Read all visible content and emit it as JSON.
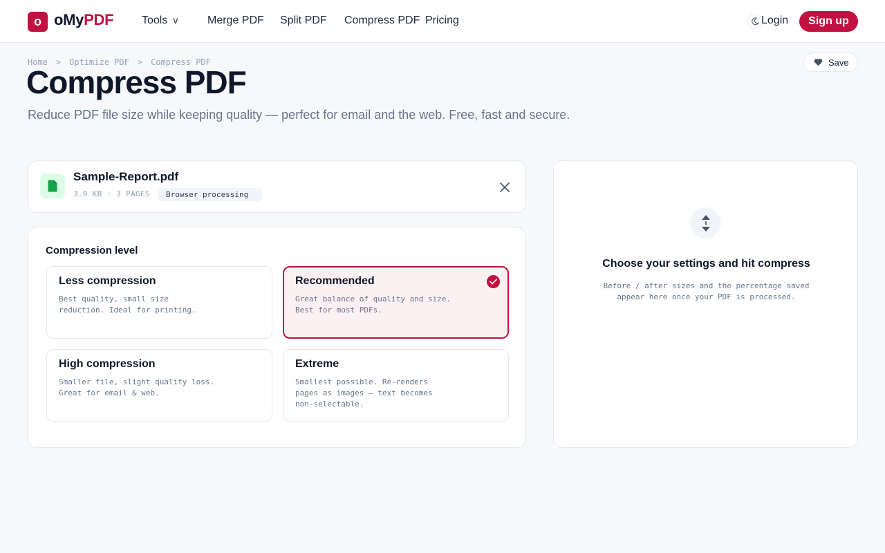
{
  "header": {
    "logo_letter": "o",
    "logo_main": "oMy",
    "logo_accent": "PDF",
    "nav": {
      "tools": "Tools",
      "tools_chevron": "v",
      "merge": "Merge PDF",
      "split": "Split PDF",
      "compress": "Compress PDF",
      "pricing": "Pricing"
    },
    "login": "Login",
    "signup": "Sign up"
  },
  "breadcrumb": [
    "Home",
    "Optimize PDF",
    "Compress PDF"
  ],
  "breadcrumb_sep": ">",
  "page": {
    "title": "Compress PDF",
    "subtitle": "Reduce PDF file size while keeping quality — perfect for email and the web. Free, fast and secure.",
    "save": "Save"
  },
  "file": {
    "name": "Sample-Report.pdf",
    "meta": "3.0 KB · 3 PAGES",
    "badge": "Browser processing"
  },
  "compression": {
    "label": "Compression level",
    "options": [
      {
        "title": "Less compression",
        "desc": "Best quality, small size reduction. Ideal for printing.",
        "selected": false
      },
      {
        "title": "Recommended",
        "desc": "Great balance of quality and size. Best for most PDFs.",
        "selected": true
      },
      {
        "title": "High compression",
        "desc": "Smaller file, slight quality loss. Great for email & web.",
        "selected": false
      },
      {
        "title": "Extreme",
        "desc": "Smallest possible. Re-renders pages as images — text becomes non-selectable.",
        "selected": false
      }
    ]
  },
  "result": {
    "title": "Choose your settings and hit compress",
    "text": "Before / after sizes and the percentage saved appear here once your PDF is processed."
  },
  "colors": {
    "brand": "#c01140",
    "selected_bg": "#fdf0f3",
    "file_icon": "#16a34a",
    "file_icon_bg": "#dcfce7"
  },
  "icons": {
    "theme": "moon-icon",
    "save": "heart-icon",
    "file": "file-icon",
    "close": "close-icon",
    "check": "check-icon",
    "result": "compress-arrows-icon"
  }
}
